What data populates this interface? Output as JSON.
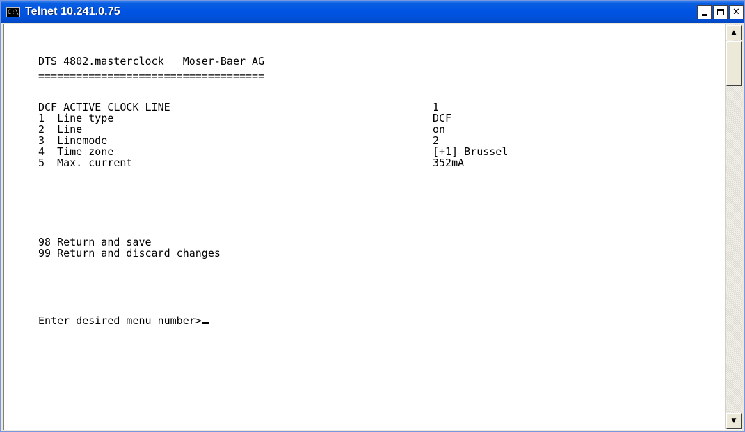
{
  "window": {
    "title": "Telnet 10.241.0.75",
    "icon": "console-icon",
    "icon_label": "C:\\"
  },
  "terminal": {
    "header": "DTS 4802.masterclock   Moser-Baer AG",
    "separator": "====================================",
    "section": {
      "label": "DCF ACTIVE CLOCK LINE",
      "value": "1"
    },
    "items": [
      {
        "label": "1  Line type",
        "value": "DCF"
      },
      {
        "label": "2  Line",
        "value": "on"
      },
      {
        "label": "3  Linemode",
        "value": "2"
      },
      {
        "label": "4  Time zone",
        "value": "[+1] Brussel"
      },
      {
        "label": "5  Max. current",
        "value": "352mA"
      }
    ],
    "actions": [
      {
        "label": "98 Return and save"
      },
      {
        "label": "99 Return and discard changes"
      }
    ],
    "prompt": "Enter desired menu number>"
  }
}
